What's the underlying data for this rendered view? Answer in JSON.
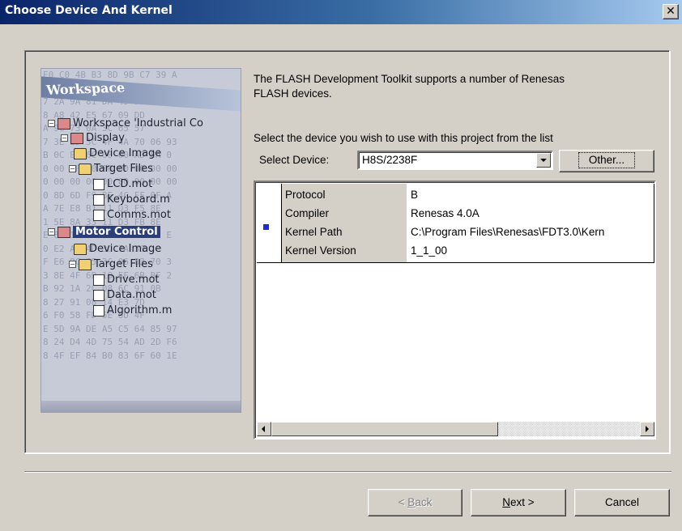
{
  "window": {
    "title": "Choose Device And Kernel",
    "close_label": "✕"
  },
  "illustration": {
    "header": "Workspace",
    "hex_lines": [
      "E0 C0 4B B3 8D 9B C7 39 A",
      "A6 D6 B1 40 DA FF 5B",
      "7 2A 9A 81 DA 4D 5D 19 2E",
      "8 A8 42 E5 67 09 DD",
      "A 9C 73 0A 3C 65 57",
      "7 3E 2D 3C 4F 4A 70 06 93",
      "B 0C EC 6C 00 00 AD BA 0",
      "0 00 FF 00 00 00 00 00 00",
      "0 00 00 00 00 00 00 00 00",
      "0 8D 6D F9 8E 4C FF 0F A",
      "A 7E E8 B1 11 D3 F5 8E",
      "1 5E 8A 33 11 D3 FB 8E",
      "E 8D 12 45 F9 DD 2E 12 E",
      "0 E2 AC 4D 3D 7A 38",
      "F E6 8C 65 3C 06 83 70 3",
      "3 8E 4F 6B 10 EE 6B BF 2",
      "B 92 1A 2C 08 6C 91 0B",
      "8 27 91 08 14 E3 7D",
      "6 F0 58 FD 5E 8D 4F",
      "E 5D 9A DE A5 C5 64 85 97",
      "8 24 D4 4D 75 54 AD 2D F6",
      "8 4F EF 84 B0 83 6F 60 1E"
    ],
    "tree": [
      {
        "label": "Workspace 'Industrial Co",
        "kind": "ws"
      },
      {
        "label": "Display",
        "kind": "ws"
      },
      {
        "label": "Device Image",
        "kind": "folder"
      },
      {
        "label": "Target Files",
        "kind": "folder"
      },
      {
        "label": "LCD.mot",
        "kind": "file"
      },
      {
        "label": "Keyboard.m",
        "kind": "file"
      },
      {
        "label": "Comms.mot",
        "kind": "file"
      },
      {
        "label": "Motor Control",
        "kind": "ws"
      },
      {
        "label": "Device Image",
        "kind": "folder"
      },
      {
        "label": "Target Files",
        "kind": "folder"
      },
      {
        "label": "Drive.mot",
        "kind": "file"
      },
      {
        "label": "Data.mot",
        "kind": "file"
      },
      {
        "label": "Algorithm.m",
        "kind": "file"
      }
    ]
  },
  "intro": {
    "line1": "The FLASH Development Toolkit supports a number of Renesas",
    "line2": "FLASH devices.",
    "select_prompt": "Select the device you wish to use with this project from the list"
  },
  "device": {
    "label": "Select Device:",
    "selected": "H8S/2238F",
    "other_button": "Other..."
  },
  "properties": [
    {
      "key": "Protocol",
      "value": "B"
    },
    {
      "key": "Compiler",
      "value": "Renesas 4.0A"
    },
    {
      "key": "Kernel Path",
      "value": "C:\\Program Files\\Renesas\\FDT3.0\\Kern"
    },
    {
      "key": "Kernel Version",
      "value": "1_1_00"
    }
  ],
  "buttons": {
    "back_prefix": "< ",
    "back_key": "B",
    "back_rest": "ack",
    "next_key": "N",
    "next_rest": "ext >",
    "cancel": "Cancel"
  },
  "colors": {
    "title_start": "#0a246a",
    "title_end": "#a6caf0",
    "face": "#d4d0c8",
    "bullet": "#1c2be0"
  }
}
